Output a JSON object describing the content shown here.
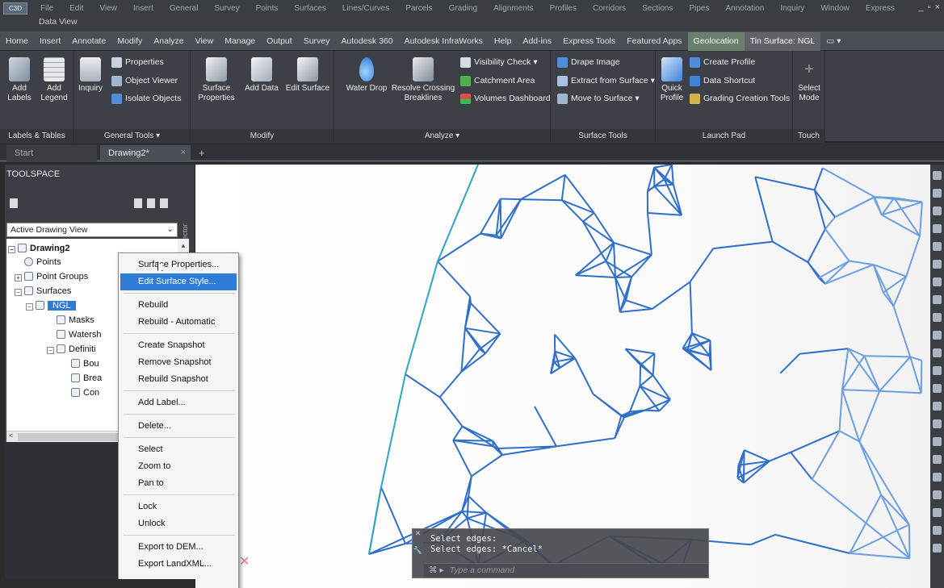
{
  "app_menu": {
    "app_button": "C3D",
    "items": [
      "File",
      "Edit",
      "View",
      "Insert",
      "General",
      "Survey",
      "Points",
      "Surfaces",
      "Lines/Curves",
      "Parcels",
      "Grading",
      "Alignments",
      "Profiles",
      "Corridors",
      "Sections",
      "Pipes",
      "Annotation",
      "Inquiry",
      "Window",
      "Express"
    ],
    "second_row": "Data View",
    "window_controls": "_ ▫ ×"
  },
  "ribbon_tabs": [
    "Home",
    "Insert",
    "Annotate",
    "Modify",
    "Analyze",
    "View",
    "Manage",
    "Output",
    "Survey",
    "Autodesk 360",
    "Autodesk InfraWorks",
    "Help",
    "Add-ins",
    "Express Tools",
    "Featured Apps",
    "Geolocation",
    "Tin Surface: NGL",
    "▭ ▾"
  ],
  "ribbon": {
    "labels_tables": {
      "title": "Labels & Tables",
      "add_labels": "Add Labels",
      "add_legend": "Add Legend"
    },
    "general_tools": {
      "title": "General Tools ▾",
      "inquiry": "Inquiry",
      "properties": "Properties",
      "object_viewer": "Object Viewer",
      "isolate_objects": "Isolate Objects"
    },
    "modify": {
      "title": "Modify",
      "surface_properties": "Surface Properties",
      "add_data": "Add Data",
      "edit_surface": "Edit Surface"
    },
    "analyze": {
      "title": "Analyze ▾",
      "water_drop": "Water Drop",
      "resolve_crossing": "Resolve Crossing Breaklines",
      "visibility_check": "Visibility Check ▾",
      "catchment_area": "Catchment Area",
      "volumes_dashboard": "Volumes Dashboard"
    },
    "surface_tools": {
      "title": "Surface Tools",
      "drape_image": "Drape Image",
      "extract_from_surface": "Extract from Surface ▾",
      "move_to_surface": "Move to Surface ▾"
    },
    "launch_pad": {
      "title": "Launch Pad",
      "quick_profile": "Quick Profile",
      "create_profile": "Create Profile",
      "data_shortcut": "Data Shortcut",
      "grading_creation_tools": "Grading Creation Tools"
    },
    "touch": {
      "title": "Touch",
      "select_mode": "Select Mode"
    }
  },
  "doc_tabs": {
    "start": "Start",
    "active": "Drawing2*",
    "close": "×",
    "plus": "+"
  },
  "toolspace": {
    "title": "TOOLSPACE",
    "view_select": "Active Drawing View",
    "prospector_label": "Prospector",
    "tree": {
      "drawing": "Drawing2",
      "points": "Points",
      "point_groups": "Point Groups",
      "surfaces": "Surfaces",
      "ngl": "NGL",
      "masks": "Masks",
      "watersheds": "Watersh",
      "definition": "Definiti",
      "boundaries": "Bou",
      "breaklines": "Brea",
      "contours": "Con"
    }
  },
  "context_menu": [
    {
      "label": "Surface Properties...",
      "highlighted": false
    },
    {
      "label": "Edit Surface Style...",
      "highlighted": true
    },
    {
      "label": "Rebuild",
      "highlighted": false
    },
    {
      "label": "Rebuild - Automatic",
      "highlighted": false
    },
    {
      "label": "Create Snapshot",
      "highlighted": false
    },
    {
      "label": "Remove Snapshot",
      "highlighted": false
    },
    {
      "label": "Rebuild Snapshot",
      "highlighted": false
    },
    {
      "label": "Add Label...",
      "highlighted": false
    },
    {
      "label": "Delete...",
      "highlighted": false
    },
    {
      "label": "Select",
      "highlighted": false
    },
    {
      "label": "Zoom to",
      "highlighted": false
    },
    {
      "label": "Pan to",
      "highlighted": false
    },
    {
      "label": "Lock",
      "highlighted": false
    },
    {
      "label": "Unlock",
      "highlighted": false
    },
    {
      "label": "Export to DEM...",
      "highlighted": false
    },
    {
      "label": "Export LandXML...",
      "highlighted": false
    }
  ],
  "command_line": {
    "history": [
      "Select edges:",
      "Select edges: *Cancel*"
    ],
    "prompt": "Type a command",
    "prefix": "⌘ ▸"
  },
  "colors": {
    "tin_edge": "#2f6fc9",
    "tin_edge_light": "#6c9ee0",
    "highlight": "#2f7cd6",
    "context_tab": "#6a7f6c"
  }
}
